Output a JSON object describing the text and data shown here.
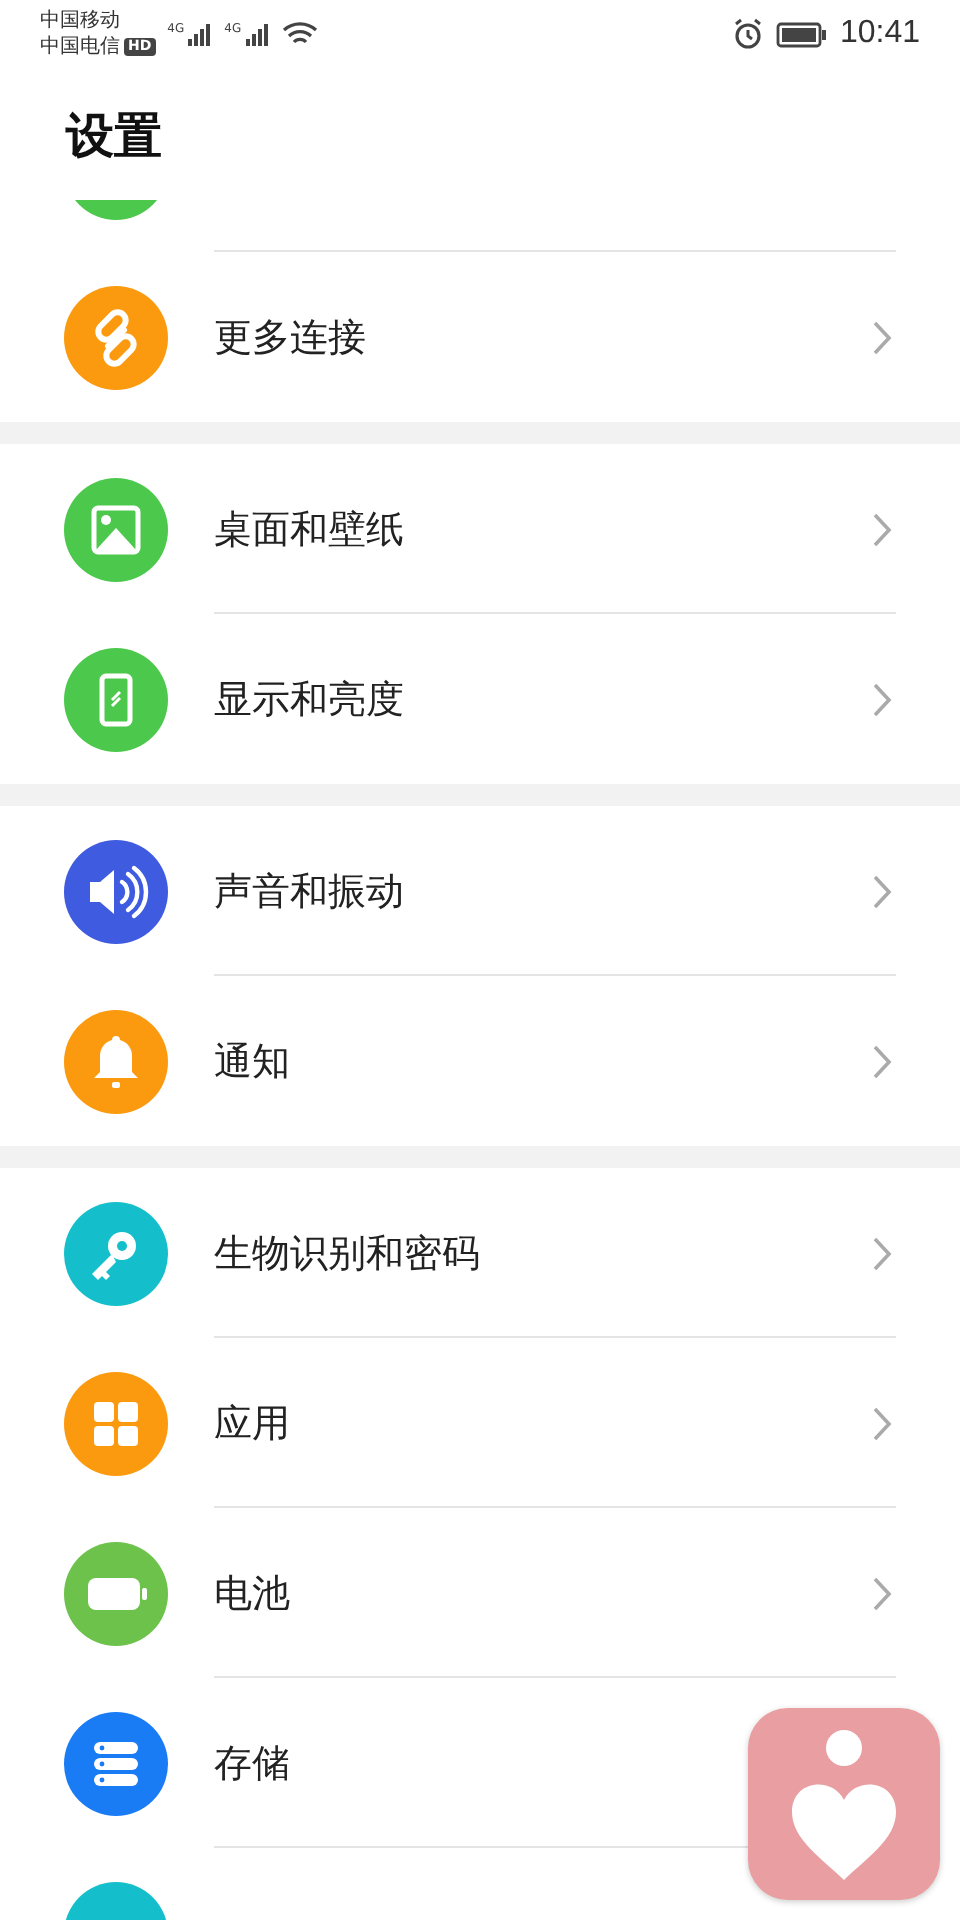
{
  "status_bar": {
    "carriers": [
      "中国移动",
      "中国电信"
    ],
    "hd_badge": "HD",
    "signals": [
      "4G",
      "4G"
    ],
    "time": "10:41"
  },
  "title": "设置",
  "sections": [
    {
      "items": [
        {
          "kind": "blank",
          "color": "#4cc94c",
          "chevron": false
        },
        {
          "label": "更多连接",
          "kind": "link",
          "color": "#fb9a0e",
          "chevron": true
        }
      ]
    },
    {
      "items": [
        {
          "label": "桌面和壁纸",
          "kind": "image",
          "color": "#4cc94c",
          "chevron": true
        },
        {
          "label": "显示和亮度",
          "kind": "phone",
          "color": "#4cc94c",
          "chevron": true
        }
      ]
    },
    {
      "items": [
        {
          "label": "声音和振动",
          "kind": "sound",
          "color": "#3f5be0",
          "chevron": true
        },
        {
          "label": "通知",
          "kind": "bell",
          "color": "#fb9a0e",
          "chevron": true
        }
      ]
    },
    {
      "items": [
        {
          "label": "生物识别和密码",
          "kind": "key",
          "color": "#14bfcb",
          "chevron": true
        },
        {
          "label": "应用",
          "kind": "grid",
          "color": "#fb9a0e",
          "chevron": true
        },
        {
          "label": "电池",
          "kind": "battery",
          "color": "#6cc24a",
          "chevron": true
        },
        {
          "label": "存储",
          "kind": "storage",
          "color": "#1a7cf5",
          "chevron": false
        },
        {
          "kind": "blank",
          "color": "#14bfcb",
          "chevron": false
        }
      ]
    }
  ]
}
